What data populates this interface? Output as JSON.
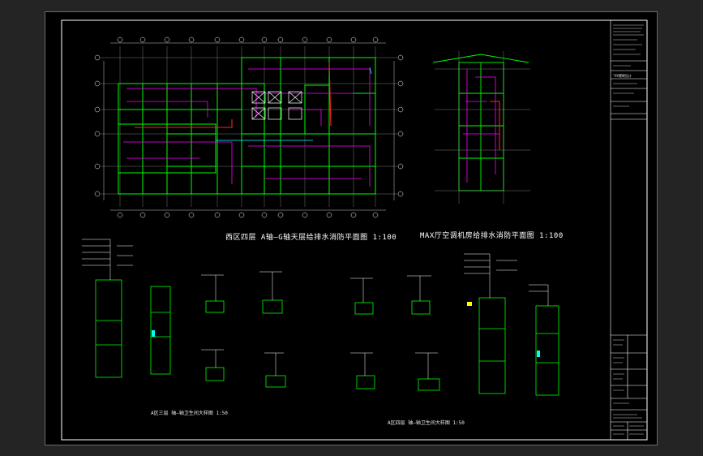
{
  "viewer": {
    "background": "#242424",
    "sheet_background": "#000000"
  },
  "drawing": {
    "plan1_title": "西区四层 A轴—G轴天层给排水消防平面图   1:100",
    "plan2_title": "MAX厅空调机房给排水消防平面图 1:100",
    "detail1_title": "A区三层 轴—轴卫生间大样图 1:50",
    "detail2_title": "A区四层 轴—轴卫生间大样图 1:50",
    "title_block_label": "xx建筑设计"
  },
  "colors": {
    "line_green": "#00ff00",
    "line_magenta": "#ff00ff",
    "line_red": "#ff2020",
    "line_white": "#ffffff",
    "line_cyan": "#00ffff",
    "line_yellow": "#ffff00"
  }
}
